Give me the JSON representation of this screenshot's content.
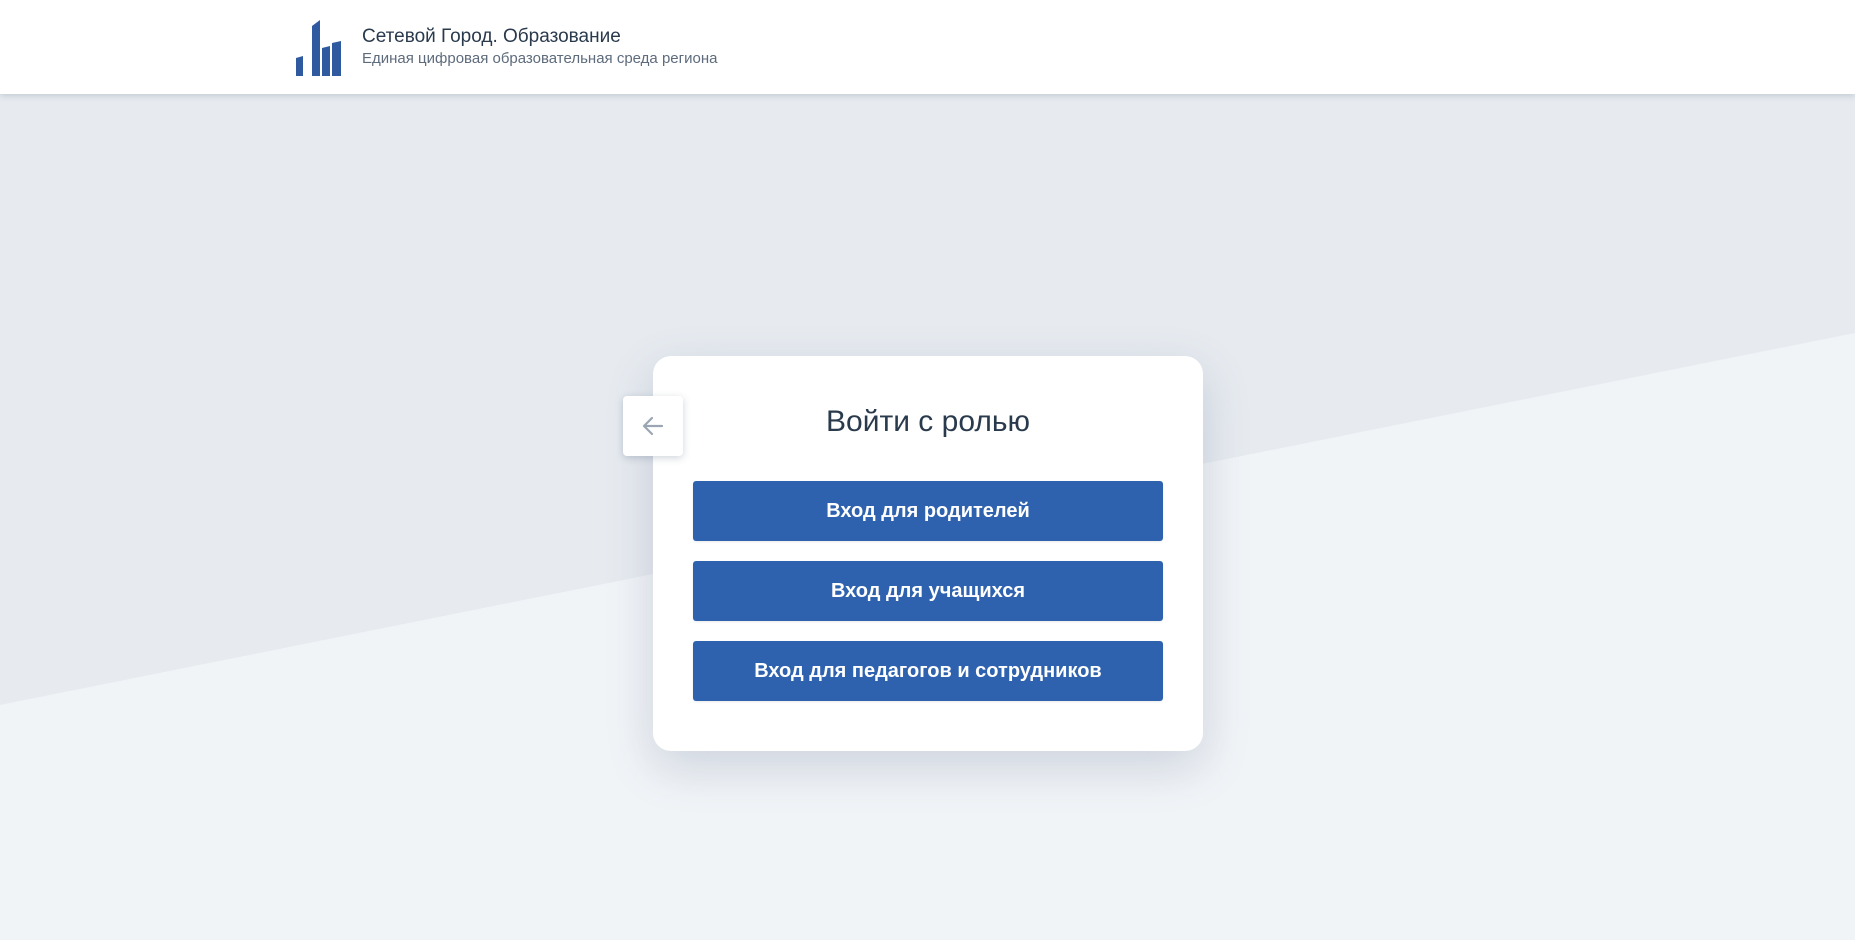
{
  "header": {
    "title": "Сетевой Город. Образование",
    "subtitle": "Единая цифровая образовательная среда региона",
    "logo_icon": "city-buildings-logo"
  },
  "login_card": {
    "title": "Войти с ролью",
    "back_icon": "arrow-left-icon",
    "buttons": {
      "parents": "Вход для родителей",
      "students": "Вход для учащихся",
      "staff": "Вход для педагогов и сотрудников"
    }
  },
  "colors": {
    "primary": "#2f62ae",
    "logo": "#2f5aa0",
    "text_dark": "#2a3a4d",
    "text_muted": "#5d6b7c",
    "bg_top": "#e7ebf0",
    "bg_bottom": "#f1f4f7"
  }
}
